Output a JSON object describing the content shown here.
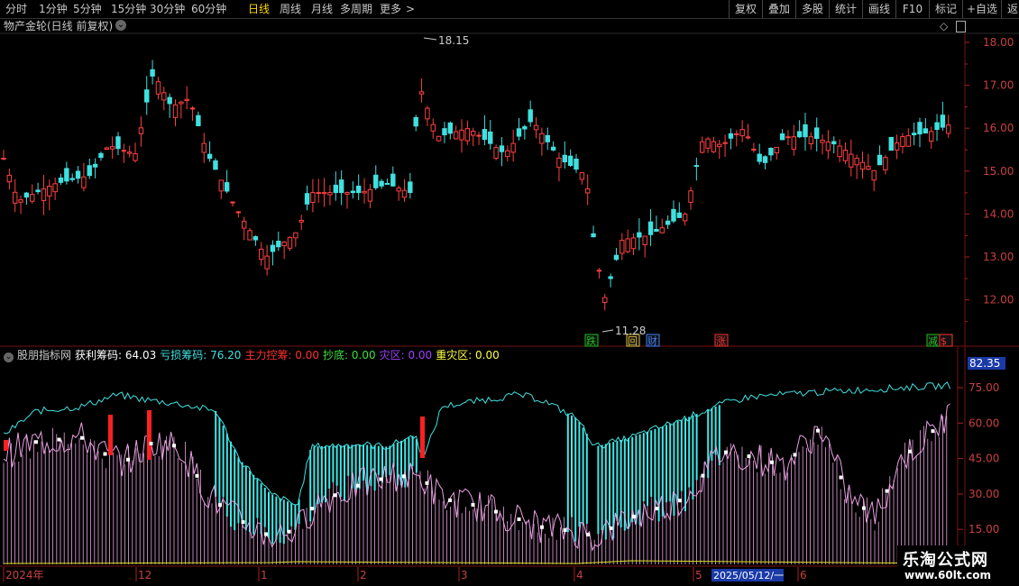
{
  "toolbar": {
    "periods": [
      "分时",
      "1分钟",
      "5分钟",
      "15分钟",
      "30分钟",
      "60分钟",
      "日线",
      "周线",
      "月线",
      "多周期",
      "更多"
    ],
    "active_period": "日线",
    "more_arrow": ">",
    "right_buttons": [
      "复权",
      "叠加",
      "多股",
      "统计",
      "画线",
      "F10",
      "标记",
      "+自选",
      "返回"
    ]
  },
  "main_panel": {
    "title": "物产金轮(日线 前复权)",
    "y_ticks": [
      "18.00",
      "17.00",
      "16.00",
      "15.00",
      "14.00",
      "13.00",
      "12.00"
    ],
    "high_label": "18.15",
    "low_label": "11.28",
    "markers": [
      "跌",
      "回",
      "财",
      "涨",
      "减",
      "$"
    ],
    "colors": {
      "up": "#ff4040",
      "down": "#40e0e0",
      "marker_red": "#ff3030",
      "marker_green": "#20c020",
      "marker_blue": "#4080ff",
      "marker_yellow": "#e0c040"
    }
  },
  "indicator_panel": {
    "title": "股朋指标网",
    "fields": [
      {
        "label": "获利筹码",
        "value": "64.03",
        "color": "#ffffff"
      },
      {
        "label": "亏损筹码",
        "value": "76.20",
        "color": "#40e0e0"
      },
      {
        "label": "主力控筹",
        "value": "0.00",
        "color": "#ff3030"
      },
      {
        "label": "抄底",
        "value": "0.00",
        "color": "#40e040"
      },
      {
        "label": "灾区",
        "value": "0.00",
        "color": "#a040ff"
      },
      {
        "label": "重灾区",
        "value": "0.00",
        "color": "#ffff40"
      }
    ],
    "y_ticks": [
      "75.00",
      "60.00",
      "45.00",
      "30.00",
      "15.00"
    ],
    "current_value": "82.35"
  },
  "time_axis": {
    "labels": [
      "2024年",
      "12",
      "1",
      "2",
      "3",
      "4",
      "5",
      "6"
    ],
    "cursor_date": "2025/05/12/一"
  },
  "watermark": {
    "title": "乐淘公式网",
    "url": "www.60lt.com"
  }
}
